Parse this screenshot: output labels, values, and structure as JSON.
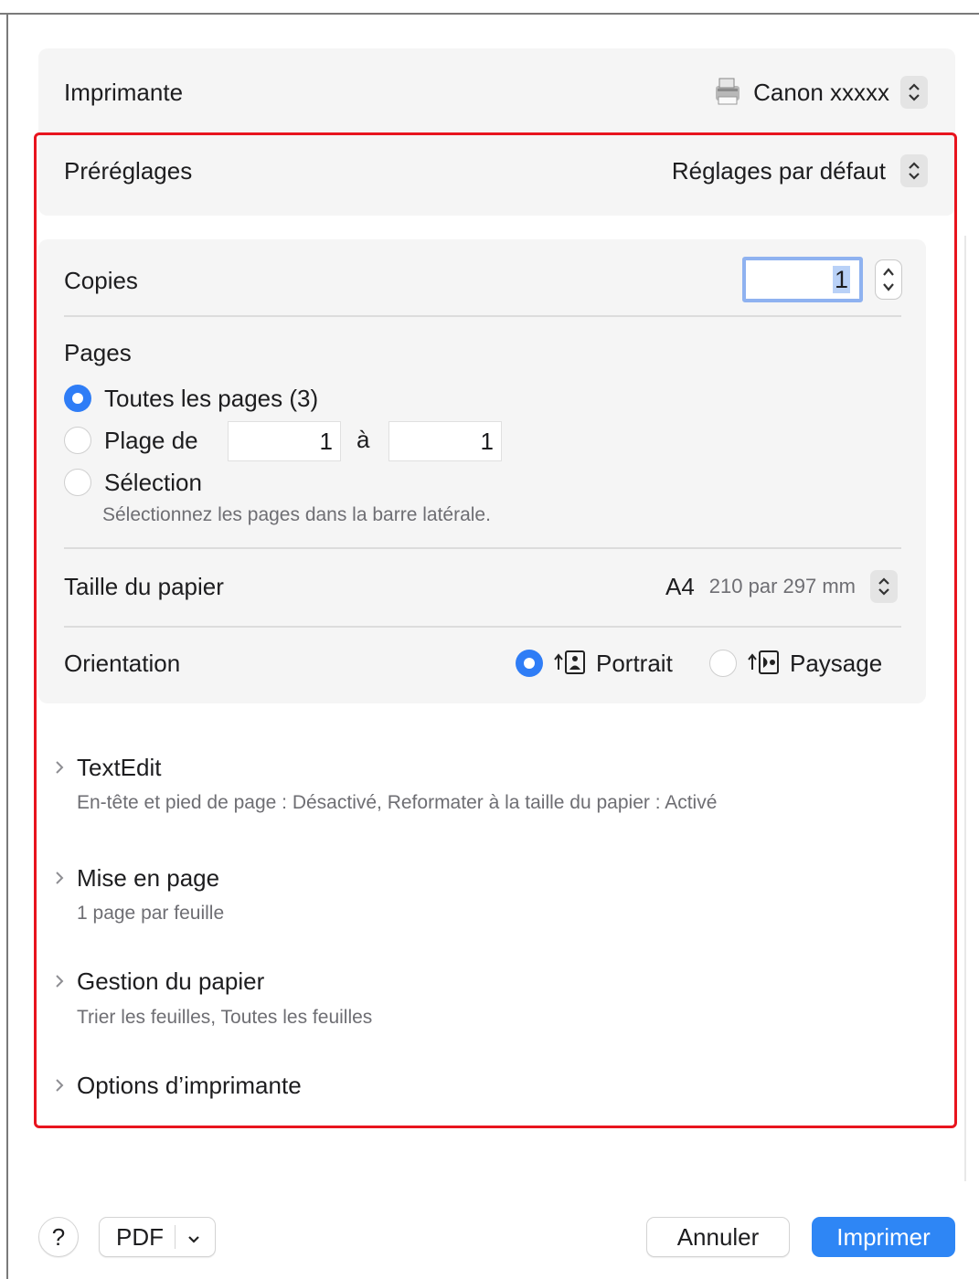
{
  "printer": {
    "label": "Imprimante",
    "value": "Canon xxxxx",
    "icon": "printer-icon"
  },
  "presets": {
    "label": "Préréglages",
    "value": "Réglages par défaut"
  },
  "copies": {
    "label": "Copies",
    "value": "1"
  },
  "pages": {
    "label": "Pages",
    "all_label": "Toutes les pages (3)",
    "range_label": "Plage de",
    "range_from": "1",
    "range_to_label": "à",
    "range_to": "1",
    "selection_label": "Sélection",
    "selection_hint": "Sélectionnez les pages dans la barre latérale.",
    "selected": "all"
  },
  "paper_size": {
    "label": "Taille du papier",
    "value": "A4",
    "detail": "210 par 297 mm"
  },
  "orientation": {
    "label": "Orientation",
    "portrait_label": "Portrait",
    "landscape_label": "Paysage",
    "selected": "portrait"
  },
  "sections": [
    {
      "title": "TextEdit",
      "summary": "En-tête et pied de page : Désactivé, Reformater à la taille du papier : Activé"
    },
    {
      "title": "Mise en page",
      "summary": "1 page par feuille"
    },
    {
      "title": "Gestion du papier",
      "summary": "Trier les feuilles, Toutes les feuilles"
    },
    {
      "title": "Options d’imprimante",
      "summary": ""
    }
  ],
  "footer": {
    "help_label": "?",
    "pdf_label": "PDF",
    "cancel_label": "Annuler",
    "print_label": "Imprimer"
  },
  "colors": {
    "accent": "#2e86f5",
    "highlight": "#e8141e",
    "panel": "#f5f5f5"
  }
}
